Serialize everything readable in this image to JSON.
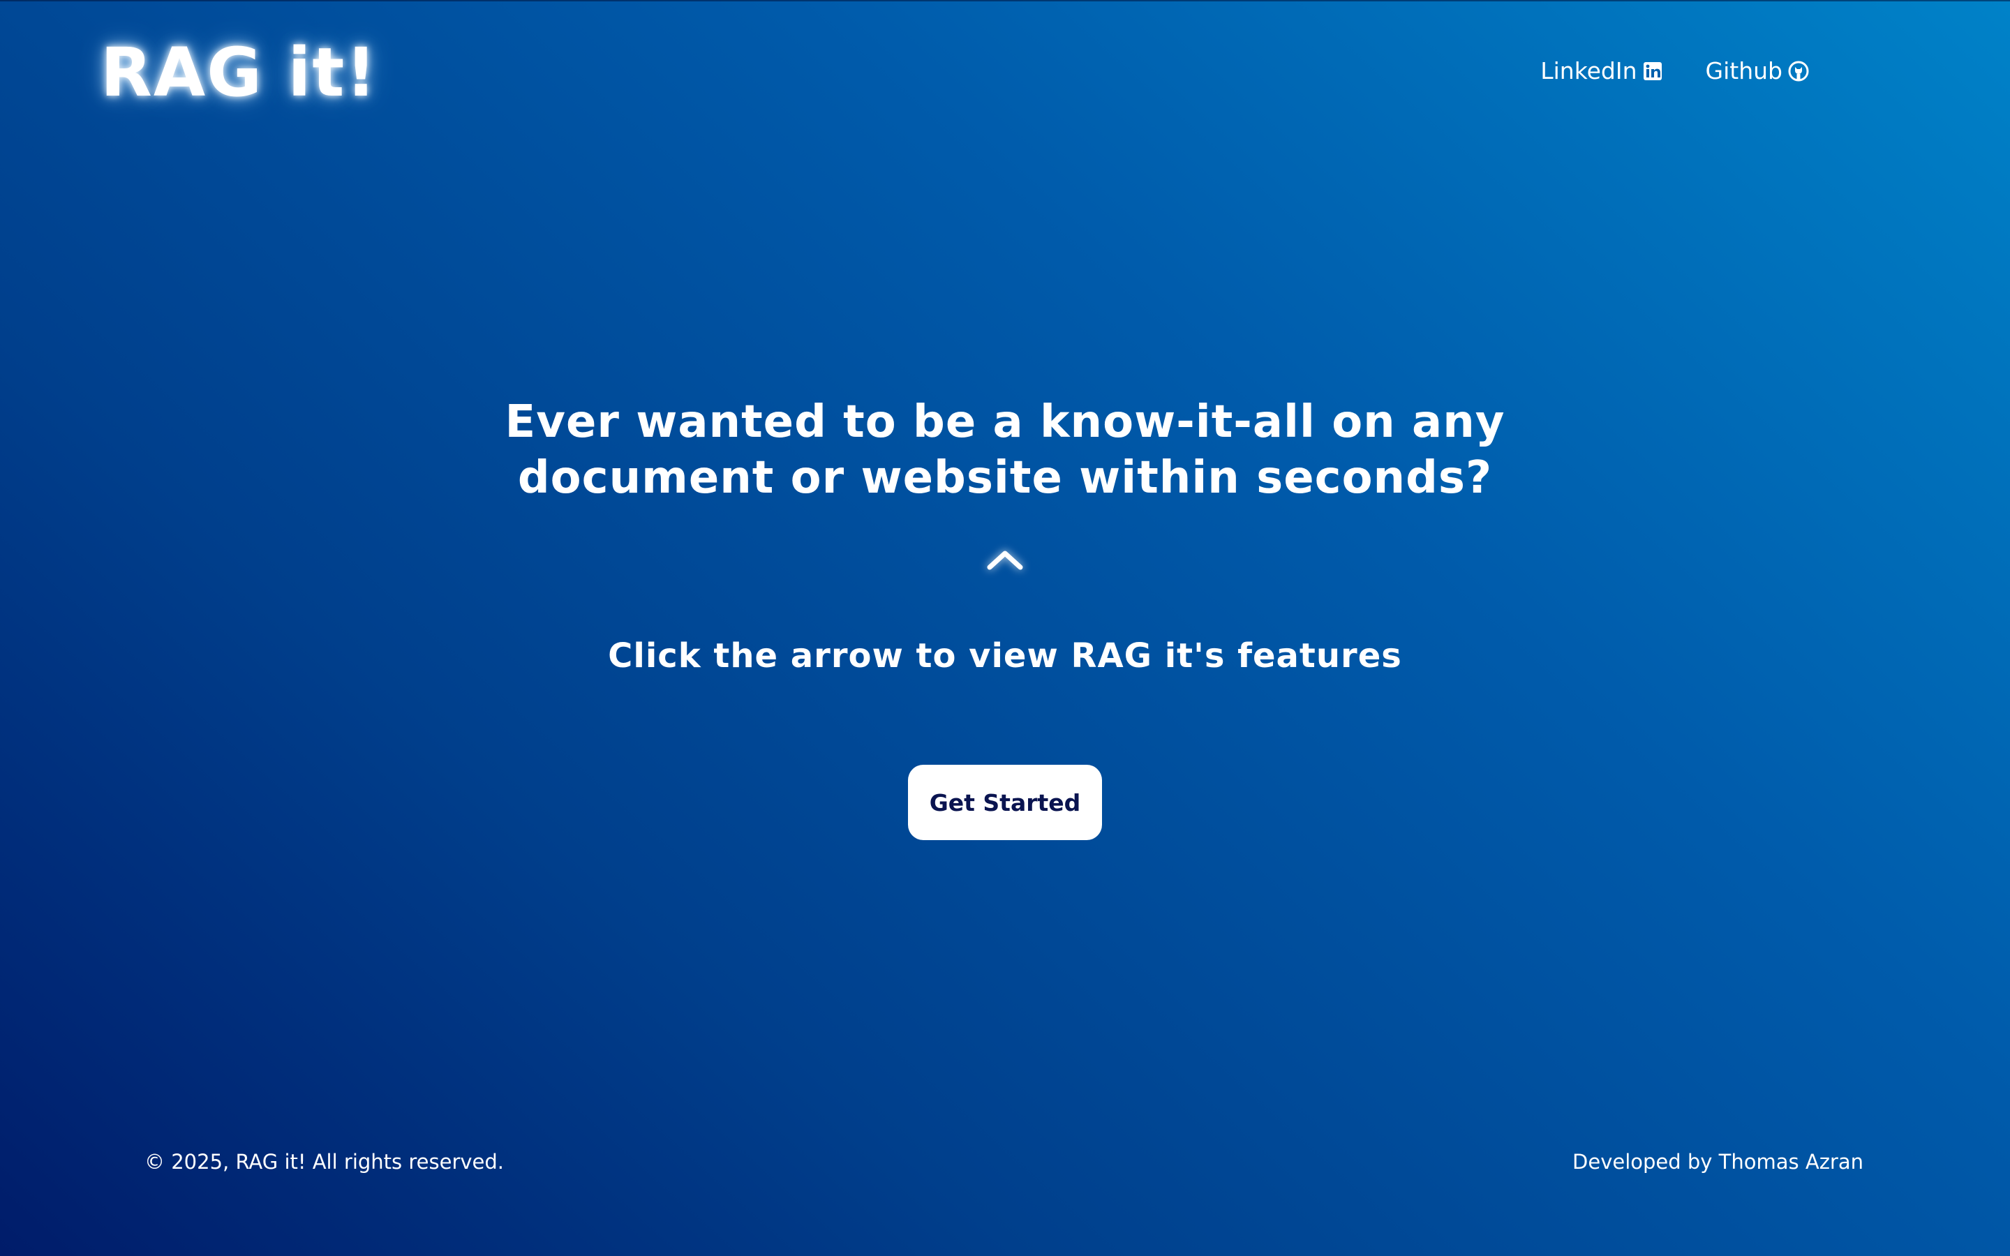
{
  "header": {
    "logo": "RAG it!",
    "nav": [
      {
        "label": "LinkedIn",
        "icon": "linkedin-icon"
      },
      {
        "label": "Github",
        "icon": "github-icon"
      }
    ]
  },
  "hero": {
    "headline": "Ever wanted to be a know-it-all on any document or website within seconds?",
    "arrow_icon": "chevron-up-icon",
    "subline": "Click the arrow to view RAG it's features",
    "cta_label": "Get Started"
  },
  "footer": {
    "copyright": "© 2025, RAG it! All rights reserved.",
    "credit": "Developed by Thomas Azran"
  },
  "colors": {
    "background_start": "#001c6a",
    "background_end": "#0082c8",
    "text": "#ffffff",
    "cta_background": "#ffffff",
    "cta_text": "#0a1450"
  }
}
